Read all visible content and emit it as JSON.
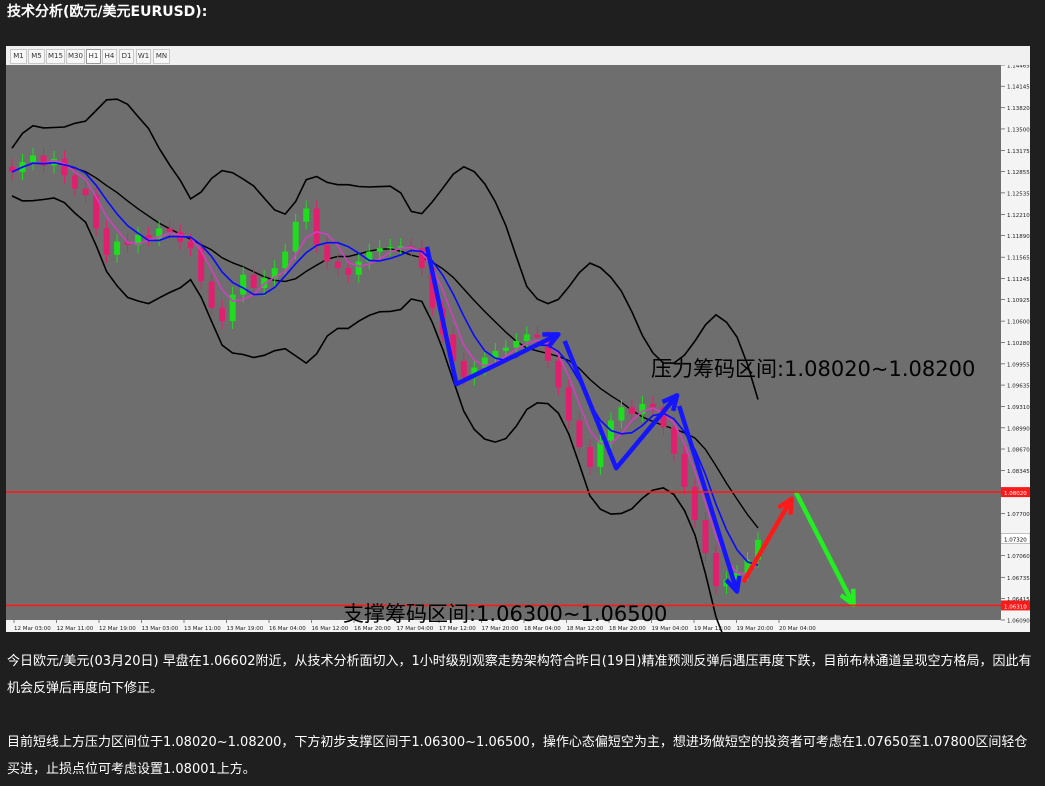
{
  "page": {
    "title": "技术分析(欧元/美元EURUSD):"
  },
  "timeframes": [
    "M1",
    "M5",
    "M15",
    "M30",
    "H1",
    "H4",
    "D1",
    "W1",
    "MN"
  ],
  "active_timeframe": "H1",
  "paragraphs": [
    "今日欧元/美元(03月20日) 早盘在1.06602附近，从技术分析面切入，1小时级别观察走势架构符合昨日(19日)精准预测反弹后遇压再度下跌，目前布林通道呈现空方格局，因此有机会反弹后再度向下修正。",
    "目前短线上方压力区间位于1.08020~1.08200，下方初步支撑区间于1.06300~1.06500，操作心态偏短空为主，想进场做短空的投资者可考虑在1.07650至1.07800区间轻仓买进，止损点位可考虑设置1.08001上方。"
  ],
  "colors": {
    "chart_bg": "#6e6e6e",
    "bull": "#1fdc1f",
    "bear": "#e0206e",
    "ma": "#0a0aff",
    "band": "#000000",
    "level_line": "#ff1a1a",
    "arrow_blue": "#1515ff",
    "arrow_red": "#ff1a1a",
    "arrow_green": "#22ee22"
  },
  "chart_data": {
    "type": "candlestick",
    "symbol": "EURUSD",
    "timeframe": "H1",
    "ylim": [
      1.0609,
      1.14465
    ],
    "y_ticks": [
      "1.14465",
      "1.14145",
      "1.13820",
      "1.13500",
      "1.13175",
      "1.12855",
      "1.12535",
      "1.12210",
      "1.11890",
      "1.11565",
      "1.11245",
      "1.10925",
      "1.10600",
      "1.10280",
      "1.09955",
      "1.09635",
      "1.09310",
      "1.08990",
      "1.08670",
      "1.08345",
      "1.07700",
      "1.07060",
      "1.06735",
      "1.06415",
      "1.06090"
    ],
    "x_ticks": [
      "12 Mar 03:00",
      "12 Mar 11:00",
      "12 Mar 19:00",
      "13 Mar 03:00",
      "13 Mar 11:00",
      "13 Mar 19:00",
      "16 Mar 04:00",
      "16 Mar 12:00",
      "16 Mar 20:00",
      "17 Mar 04:00",
      "17 Mar 12:00",
      "17 Mar 20:00",
      "18 Mar 04:00",
      "18 Mar 12:00",
      "18 Mar 20:00",
      "19 Mar 04:00",
      "19 Mar 12:00",
      "19 Mar 20:00",
      "20 Mar 04:00"
    ],
    "level_markers": [
      {
        "label": "1.08020",
        "value": 1.0802
      },
      {
        "label": "1.07320",
        "value": 1.0732
      },
      {
        "label": "1.06310",
        "value": 1.0631
      }
    ],
    "horizontal_lines": [
      1.0802,
      1.0631
    ],
    "annotations": [
      {
        "text": "压力筹码区间:1.08020~1.08200"
      },
      {
        "text": "支撑筹码区间:1.06300~1.06500"
      }
    ],
    "close": [
      1.1285,
      1.13,
      1.131,
      1.1295,
      1.1305,
      1.128,
      1.126,
      1.125,
      1.12,
      1.116,
      1.118,
      1.1175,
      1.119,
      1.1185,
      1.12,
      1.1195,
      1.118,
      1.117,
      1.112,
      1.108,
      1.106,
      1.11,
      1.113,
      1.111,
      1.1125,
      1.114,
      1.1165,
      1.121,
      1.123,
      1.1175,
      1.115,
      1.114,
      1.113,
      1.115,
      1.1165,
      1.117,
      1.1172,
      1.1173,
      1.117,
      1.114,
      1.108,
      1.104,
      1.1,
      1.0975,
      1.099,
      1.1005,
      1.1015,
      1.102,
      1.103,
      1.104,
      1.1035,
      1.1,
      1.096,
      1.091,
      1.087,
      1.084,
      1.088,
      1.091,
      1.093,
      1.092,
      1.0935,
      1.093,
      1.09,
      1.086,
      1.081,
      1.076,
      1.071,
      1.066,
      1.067,
      1.068,
      1.07,
      1.073
    ]
  }
}
